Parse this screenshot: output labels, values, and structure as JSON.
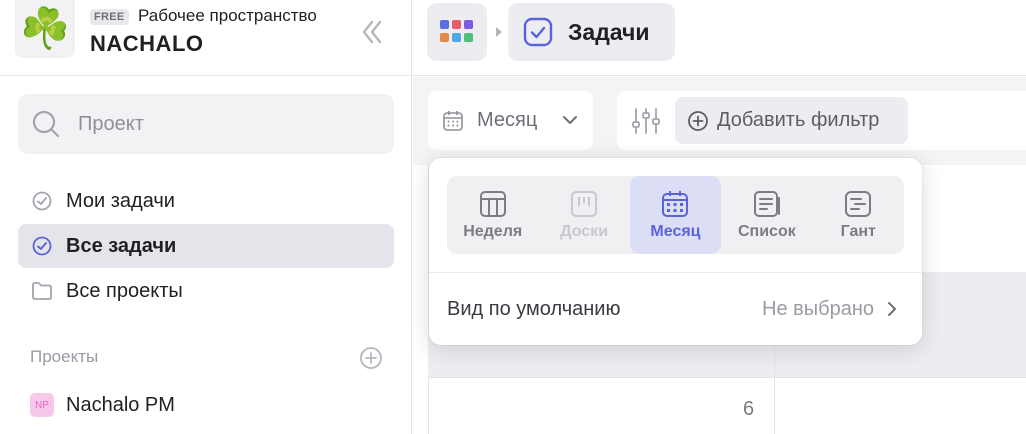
{
  "workspace": {
    "logo_icon": "clover-icon",
    "plan_badge": "FREE",
    "label": "Рабочее пространство",
    "name": "NACHALO"
  },
  "search": {
    "placeholder": "Проект"
  },
  "nav": {
    "items": [
      {
        "label": "Мои задачи",
        "icon": "check-circle-icon",
        "active": false
      },
      {
        "label": "Все задачи",
        "icon": "check-circle-icon",
        "active": true
      },
      {
        "label": "Все проекты",
        "icon": "folder-icon",
        "active": false
      }
    ]
  },
  "projects": {
    "section_title": "Проекты",
    "items": [
      {
        "badge": "NP",
        "name": "Nachalo PM",
        "badge_color": "#f7c8ea"
      }
    ]
  },
  "breadcrumb": {
    "current": "Задачи"
  },
  "toolbar": {
    "view_select": "Месяц",
    "add_filter": "Добавить фильтр"
  },
  "calendar": {
    "visible_day": "6"
  },
  "view_popup": {
    "options": [
      {
        "label": "Неделя",
        "icon": "week-view-icon",
        "state": "normal"
      },
      {
        "label": "Доски",
        "icon": "board-view-icon",
        "state": "disabled"
      },
      {
        "label": "Месяц",
        "icon": "calendar-icon",
        "state": "active"
      },
      {
        "label": "Список",
        "icon": "list-view-icon",
        "state": "normal"
      },
      {
        "label": "Гант",
        "icon": "gantt-view-icon",
        "state": "normal"
      }
    ],
    "default_label": "Вид по умолчанию",
    "default_value": "Не выбрано"
  },
  "colors": {
    "accent": "#5a63d8",
    "accent_bg": "#dcdef5",
    "active_nav_bg": "#e4e4eb"
  }
}
